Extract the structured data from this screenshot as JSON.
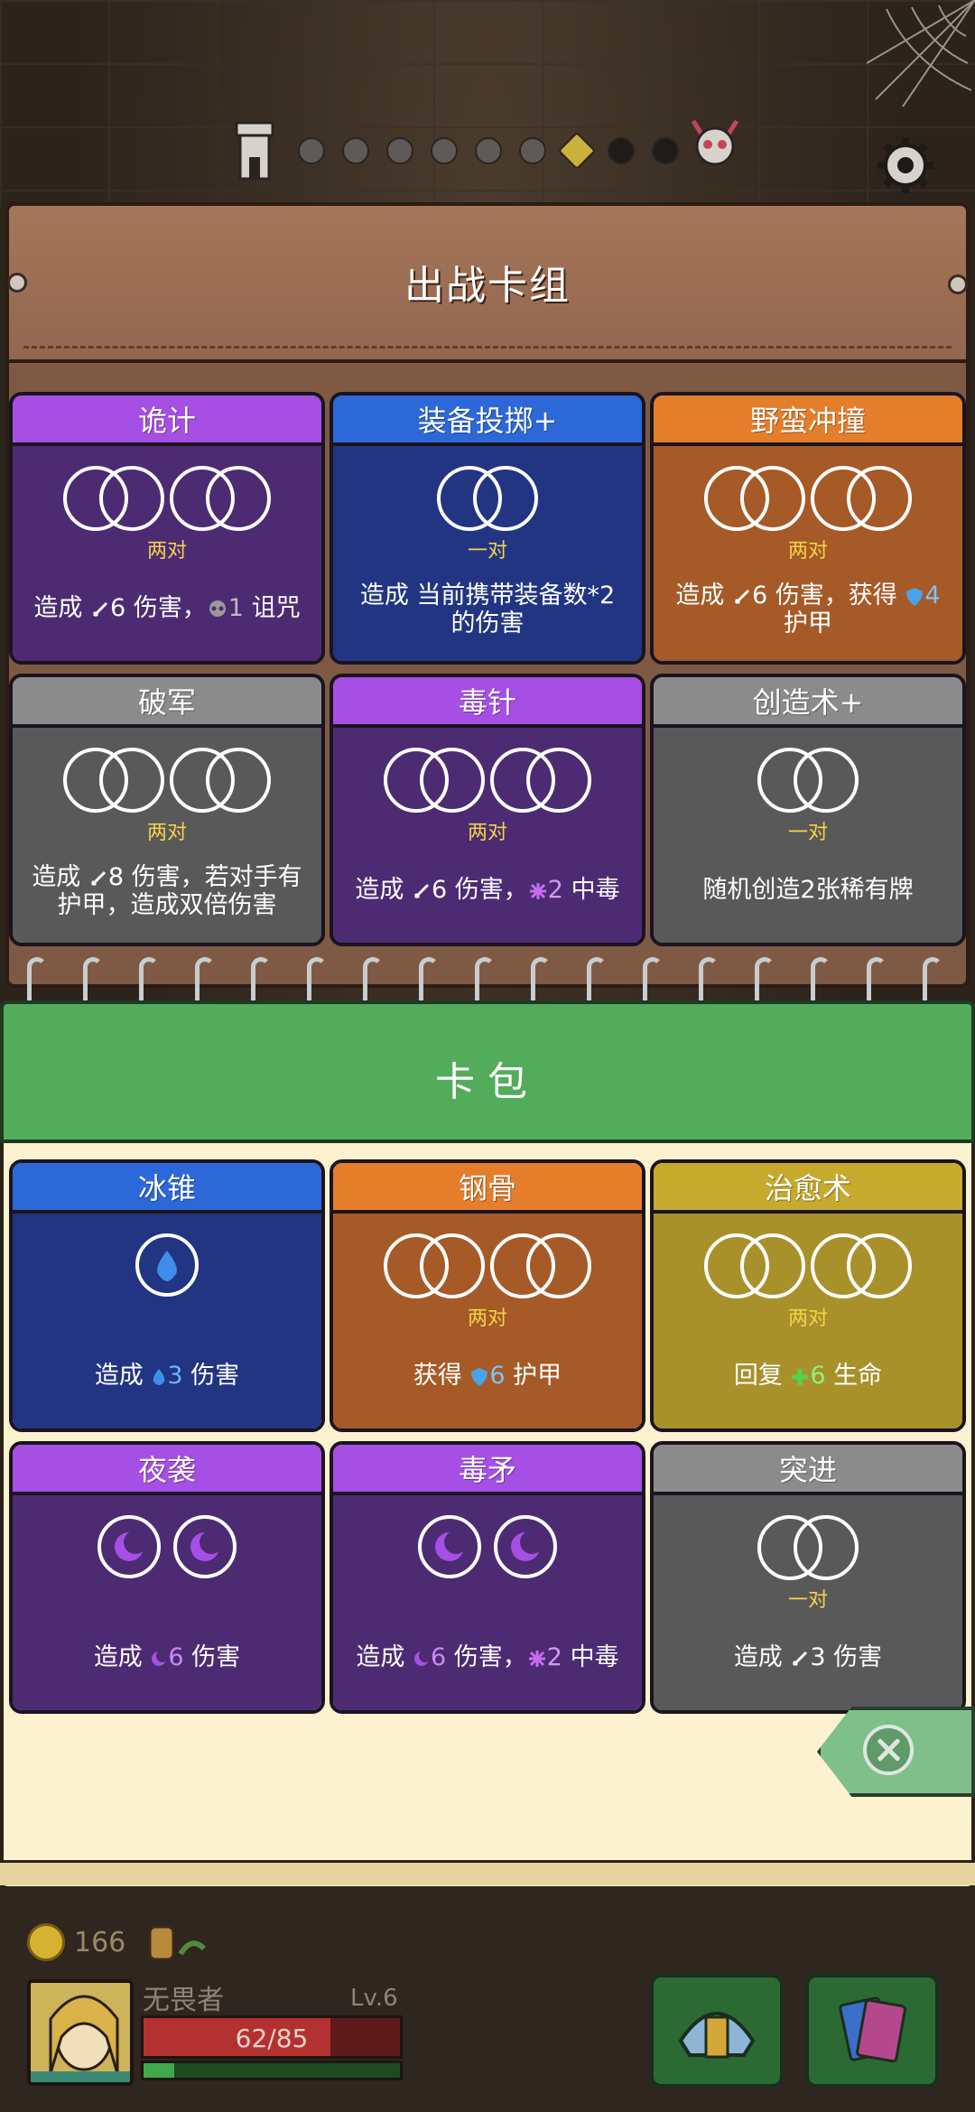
{
  "colors": {
    "purple_head": "#a64fe4",
    "blue_head": "#2d68d8",
    "orange_head": "#e57e2b",
    "gray_head": "#8b8b8b",
    "gold_head": "#c6aa2e",
    "pack_green": "#52ac5c",
    "pair_label": "#f3d34a"
  },
  "deck": {
    "title": "出战卡组",
    "cards": [
      {
        "name": "诡计",
        "type": "两对",
        "desc": [
          "造成 ",
          "6",
          " 伤害，",
          "1",
          " 诅咒"
        ]
      },
      {
        "name": "装备投掷+",
        "type": "一对",
        "desc_text": "造成 当前携带装备数*2 的伤害"
      },
      {
        "name": "野蛮冲撞",
        "type": "两对",
        "desc_line1": [
          "造成 ",
          "6",
          " 伤害，获得 ",
          "4"
        ],
        "desc_line2": "护甲"
      },
      {
        "name": "破军",
        "type": "两对",
        "desc_line1": [
          "造成 ",
          "8",
          " 伤害，若对手有"
        ],
        "desc_line2": "护甲，造成双倍伤害"
      },
      {
        "name": "毒针",
        "type": "两对",
        "desc": [
          "造成 ",
          "6",
          " 伤害，",
          "2",
          " 中毒"
        ]
      },
      {
        "name": "创造术+",
        "type": "一对",
        "desc_text": "随机创造2张稀有牌"
      }
    ]
  },
  "pack": {
    "title": "卡包",
    "cards": [
      {
        "name": "冰锥",
        "desc": [
          "造成 ",
          "3",
          " 伤害"
        ]
      },
      {
        "name": "钢骨",
        "type": "两对",
        "desc": [
          "获得 ",
          "6",
          " 护甲"
        ]
      },
      {
        "name": "治愈术",
        "type": "两对",
        "desc": [
          "回复 ",
          "6",
          " 生命"
        ]
      },
      {
        "name": "夜袭",
        "desc": [
          "造成 ",
          "6",
          " 伤害"
        ]
      },
      {
        "name": "毒矛",
        "desc": [
          "造成 ",
          "6",
          " 伤害，",
          "2",
          " 中毒"
        ]
      },
      {
        "name": "突进",
        "type": "一对",
        "desc": [
          "造成 ",
          "3",
          " 伤害"
        ]
      }
    ]
  },
  "progress": {
    "total_nodes": 8,
    "current_node": 7
  },
  "hud": {
    "gold": "166",
    "hero_name": "无畏者",
    "level": "Lv.6",
    "hp": "62/85",
    "hp_fraction": 0.73,
    "xp_fraction": 0.12
  },
  "icons": {
    "attack": "sword-icon",
    "curse": "skull-icon",
    "armor": "shield-icon",
    "poison": "poison-icon",
    "water": "water-drop-icon",
    "heal": "plus-icon",
    "moon": "moon-icon"
  }
}
